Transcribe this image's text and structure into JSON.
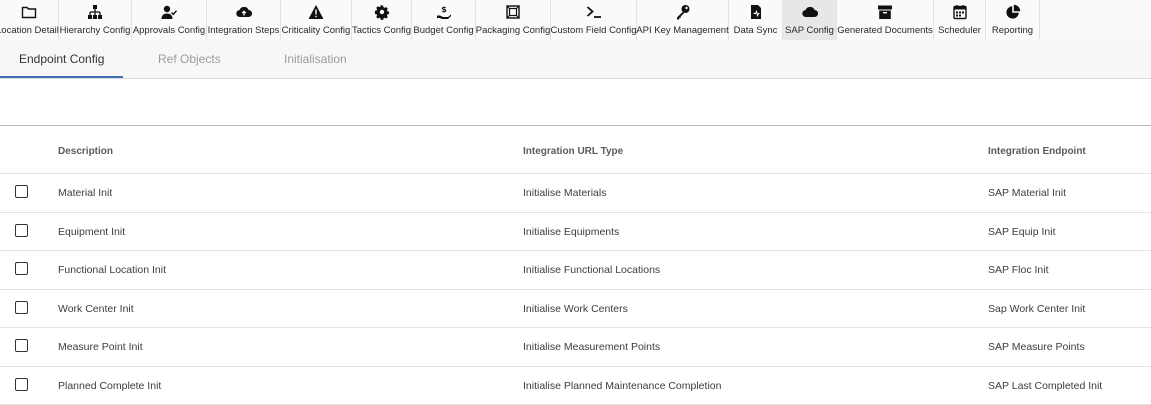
{
  "nav": {
    "items": [
      {
        "label": "Location Detail",
        "icon": "folder-icon"
      },
      {
        "label": "Hierarchy Config",
        "icon": "hierarchy-icon"
      },
      {
        "label": "Approvals Config",
        "icon": "user-check-icon"
      },
      {
        "label": "Integration Steps",
        "icon": "cloud-upload-icon"
      },
      {
        "label": "Criticality Config",
        "icon": "warning-icon"
      },
      {
        "label": "Tactics Config",
        "icon": "gear-icon"
      },
      {
        "label": "Budget Config",
        "icon": "hand-dollar-icon"
      },
      {
        "label": "Packaging Config",
        "icon": "package-icon"
      },
      {
        "label": "Custom Field Config",
        "icon": "terminal-icon"
      },
      {
        "label": "API Key Management",
        "icon": "key-icon"
      },
      {
        "label": "Data Sync",
        "icon": "file-sync-icon"
      },
      {
        "label": "SAP Config",
        "icon": "cloud-icon"
      },
      {
        "label": "Generated Documents",
        "icon": "archive-icon"
      },
      {
        "label": "Scheduler",
        "icon": "calendar-icon"
      },
      {
        "label": "Reporting",
        "icon": "pie-chart-icon"
      }
    ],
    "active": "SAP Config"
  },
  "tabs": [
    {
      "label": "Endpoint Config"
    },
    {
      "label": "Ref Objects"
    },
    {
      "label": "Initialisation"
    }
  ],
  "table": {
    "headers": {
      "description": "Description",
      "url_type": "Integration URL Type",
      "endpoint": "Integration Endpoint"
    },
    "rows": [
      {
        "description": "Material Init",
        "url_type": "Initialise Materials",
        "endpoint": "SAP Material Init"
      },
      {
        "description": "Equipment Init",
        "url_type": "Initialise Equipments",
        "endpoint": "SAP Equip Init"
      },
      {
        "description": "Functional Location Init",
        "url_type": "Initialise Functional Locations",
        "endpoint": "SAP Floc Init"
      },
      {
        "description": "Work Center Init",
        "url_type": "Initialise Work Centers",
        "endpoint": "Sap Work Center Init"
      },
      {
        "description": "Measure Point Init",
        "url_type": "Initialise Measurement Points",
        "endpoint": "SAP Measure Points"
      },
      {
        "description": "Planned Complete Init",
        "url_type": "Initialise Planned Maintenance Completion",
        "endpoint": "SAP Last Completed Init"
      }
    ]
  },
  "colors": {
    "accent": "#3f6fb5",
    "active_nav_bg": "#e7e7e7"
  }
}
